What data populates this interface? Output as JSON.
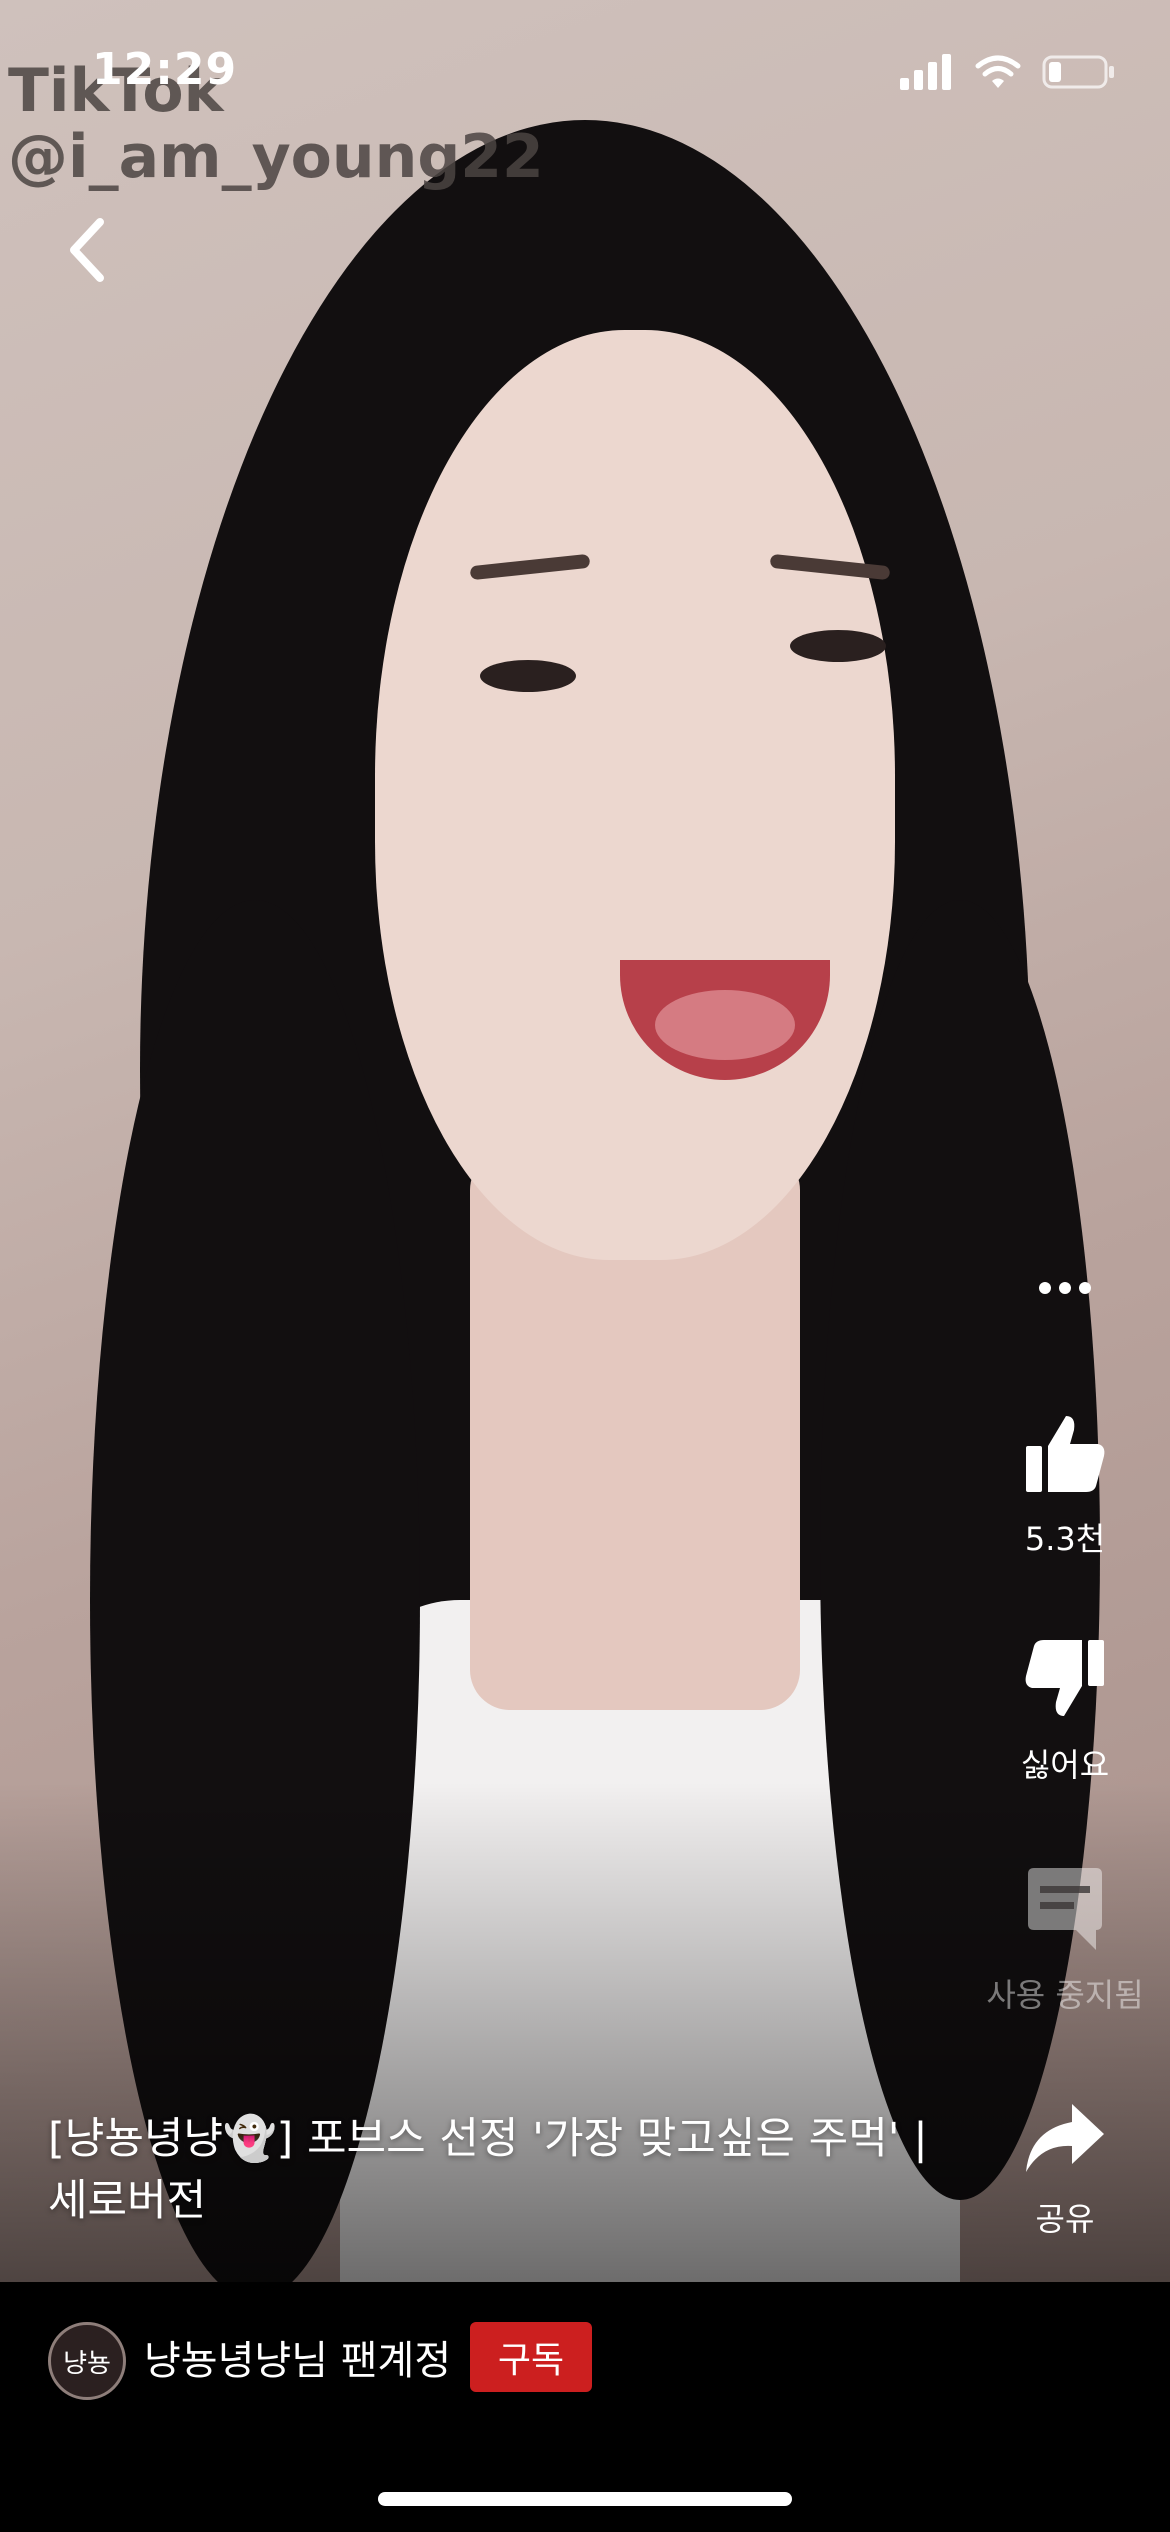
{
  "status": {
    "time": "12:29"
  },
  "watermark": {
    "brand": "TikTok",
    "handle": "@i_am_young22"
  },
  "actions": {
    "like_count": "5.3천",
    "dislike_label": "싫어요",
    "comments_label": "사용 중지됨",
    "share_label": "공유"
  },
  "video": {
    "title": "[냥뇽녕냥👻] 포브스 선정 '가장 맞고싶은 주먹' | 세로버전"
  },
  "channel": {
    "avatar_text": "냥뇽",
    "name": "냥뇽녕냥님 팬계정",
    "subscribe_label": "구독"
  },
  "colors": {
    "subscribe": "#cc1f1f",
    "background": "#000000"
  }
}
